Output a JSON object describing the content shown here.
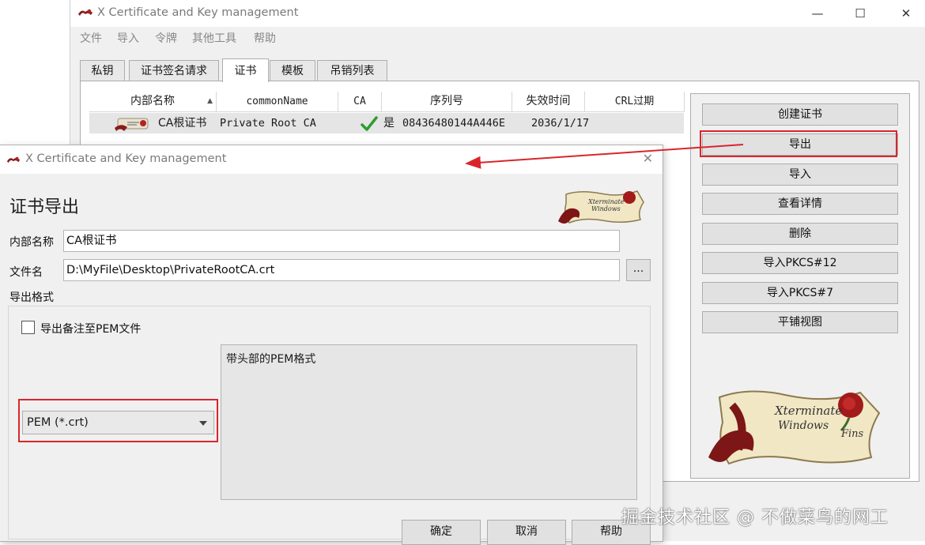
{
  "main": {
    "title": "X Certificate and Key management",
    "controls": {
      "minimize": "—",
      "maximize": "☐",
      "close": "✕"
    },
    "menu": [
      "文件",
      "导入",
      "令牌",
      "其他工具",
      "帮助"
    ],
    "tabs": [
      "私钥",
      "证书签名请求",
      "证书",
      "模板",
      "吊销列表"
    ],
    "active_tab": "证书",
    "table": {
      "columns": [
        "内部名称",
        "commonName",
        "CA",
        "序列号",
        "失效时间",
        "CRL过期"
      ],
      "rows": [
        {
          "internal_name": "CA根证书",
          "common_name": "Private Root CA",
          "ca": "是",
          "serial": "08436480144A446E",
          "expiry": "2036/1/17",
          "crl_expiry": ""
        }
      ]
    },
    "buttons": [
      "创建证书",
      "导出",
      "导入",
      "查看详情",
      "删除",
      "导入PKCS#12",
      "导入PKCS#7",
      "平铺视图"
    ]
  },
  "dialog": {
    "title": "X Certificate and Key management",
    "close": "✕",
    "heading": "证书导出",
    "internal_name_label": "内部名称",
    "internal_name_value": "CA根证书",
    "filename_label": "文件名",
    "filename_value": "D:\\MyFile\\Desktop\\PrivateRootCA.crt",
    "browse": "...",
    "format_label": "导出格式",
    "pem_comment_label": "导出备注至PEM文件",
    "pem_comment_checked": false,
    "format_selected": "PEM (*.crt)",
    "format_description": "带头部的PEM格式",
    "ok": "确定",
    "cancel": "取消",
    "help": "帮助"
  },
  "annotation": {
    "highlight_color": "#d9262b"
  },
  "watermark": "掘金技术社区 @ 不做菜鸟的网工"
}
